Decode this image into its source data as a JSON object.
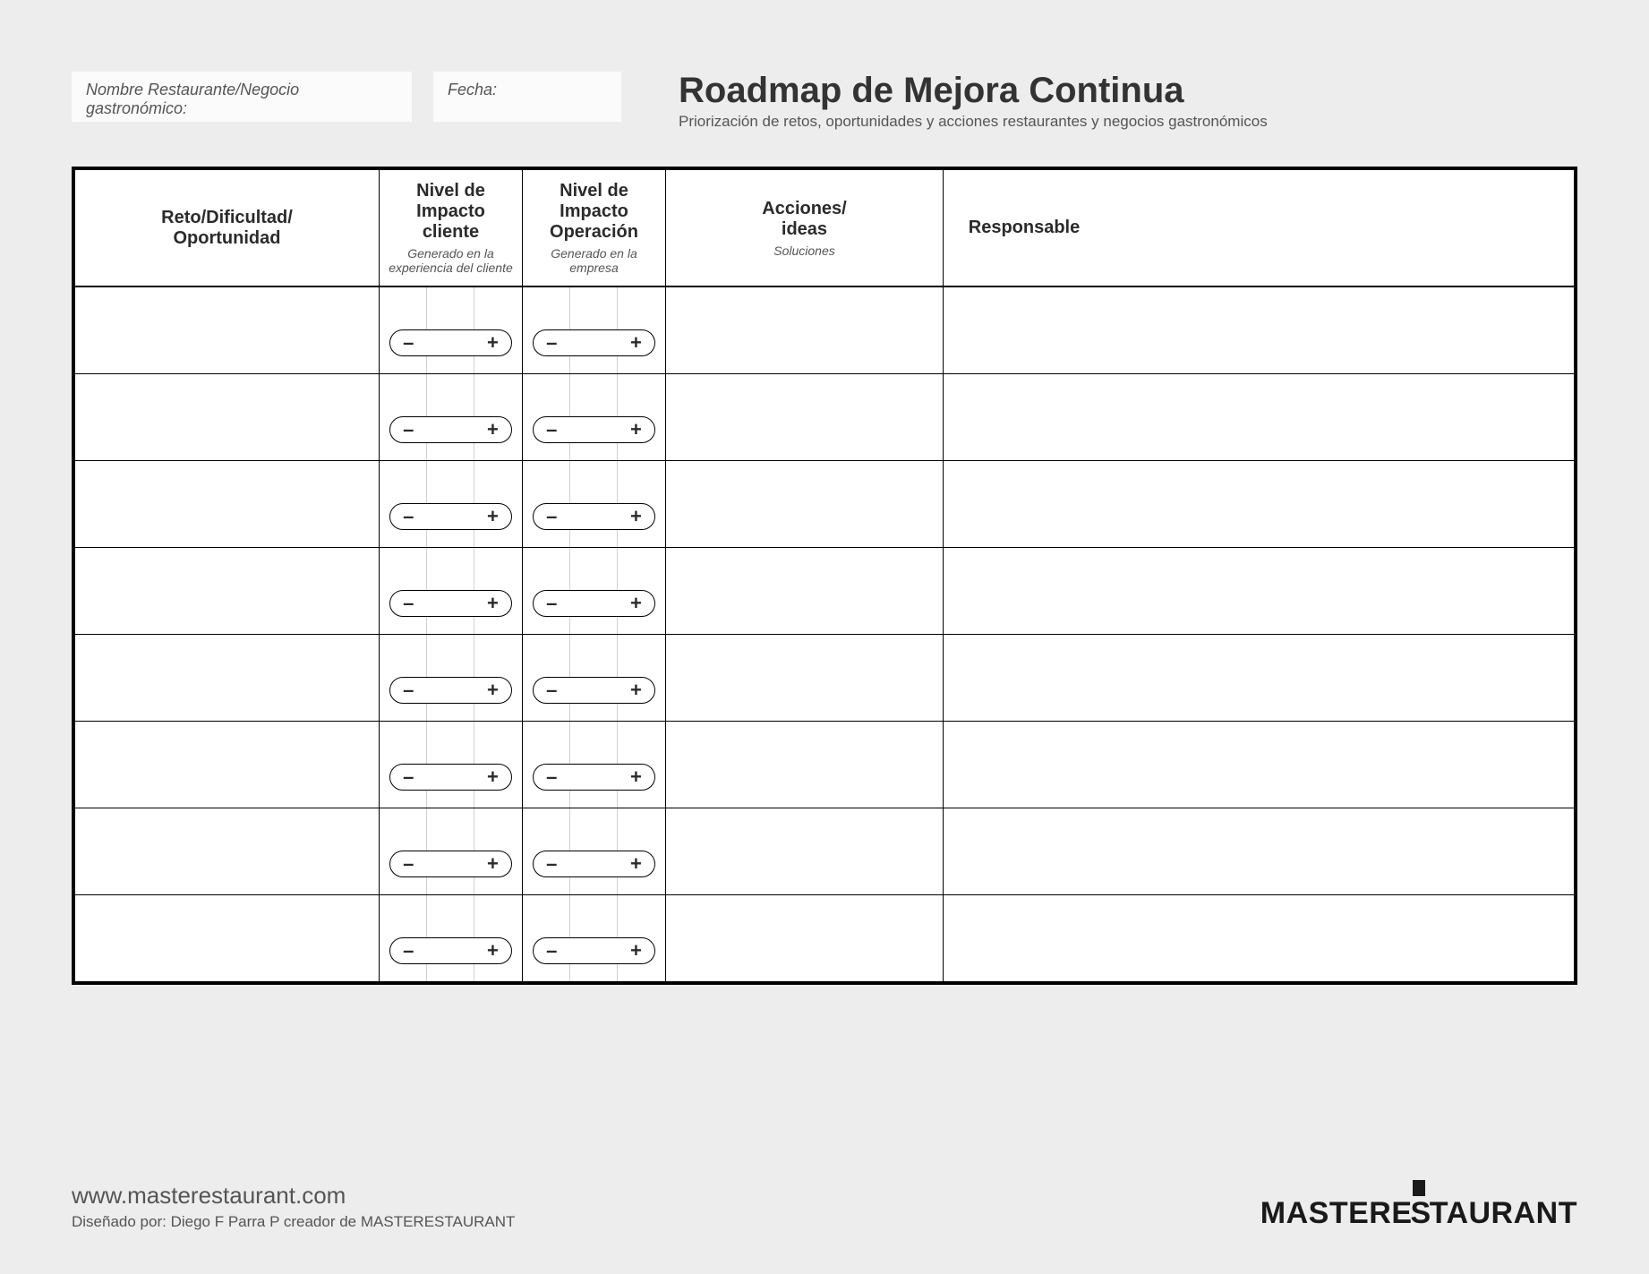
{
  "form": {
    "name_label": "Nombre Restaurante/Negocio gastronómico:",
    "date_label": "Fecha:"
  },
  "header": {
    "title": "Roadmap de Mejora Continua",
    "subtitle": "Priorización de retos, oportunidades y acciones restaurantes y negocios gastronómicos"
  },
  "columns": {
    "c1": {
      "main": "Reto/Dificultad/\nOportunidad"
    },
    "c2": {
      "main": "Nivel de\nImpacto cliente",
      "sub": "Generado en la experiencia del cliente"
    },
    "c3": {
      "main": "Nivel de\nImpacto Operación",
      "sub": "Generado en la empresa"
    },
    "c4": {
      "main": "Acciones/\nideas",
      "sub": "Soluciones"
    },
    "c5": {
      "main": "Responsable"
    }
  },
  "pill": {
    "minus": "–",
    "plus": "+"
  },
  "row_count": 8,
  "footer": {
    "url": "www.masterestaurant.com",
    "credit": "Diseñado por: Diego F Parra P creador de MASTERESTAURANT"
  },
  "logo": {
    "left": "MASTERE",
    "s": "S",
    "right": "TAURANT"
  }
}
